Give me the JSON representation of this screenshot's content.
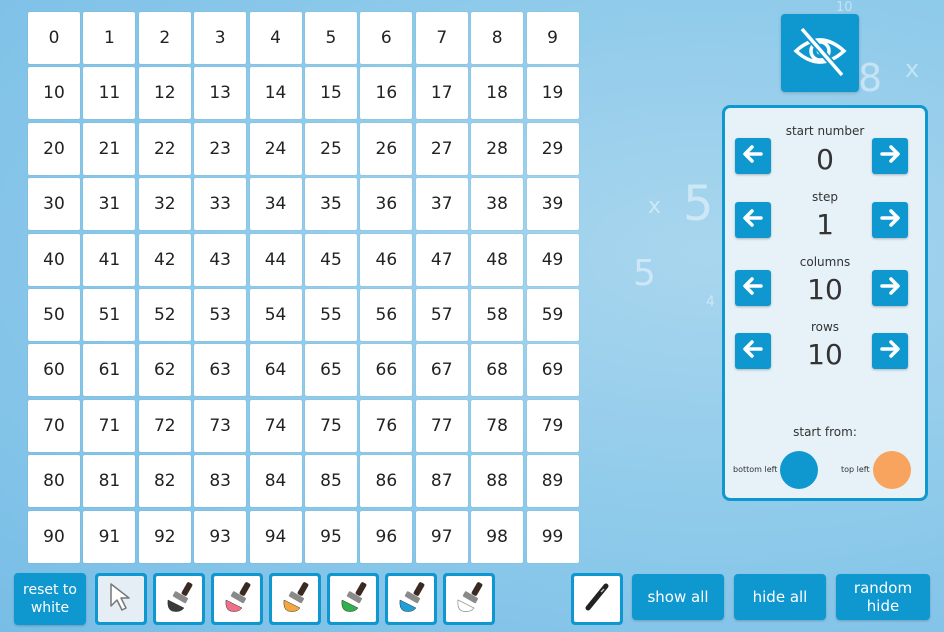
{
  "grid": {
    "rows": [
      [
        "0",
        "1",
        "2",
        "3",
        "4",
        "5",
        "6",
        "7",
        "8",
        "9"
      ],
      [
        "10",
        "11",
        "12",
        "13",
        "14",
        "15",
        "16",
        "17",
        "18",
        "19"
      ],
      [
        "20",
        "21",
        "22",
        "23",
        "24",
        "25",
        "26",
        "27",
        "28",
        "29"
      ],
      [
        "30",
        "31",
        "32",
        "33",
        "34",
        "35",
        "36",
        "37",
        "38",
        "39"
      ],
      [
        "40",
        "41",
        "42",
        "43",
        "44",
        "45",
        "46",
        "47",
        "48",
        "49"
      ],
      [
        "50",
        "51",
        "52",
        "53",
        "54",
        "55",
        "56",
        "57",
        "58",
        "59"
      ],
      [
        "60",
        "61",
        "62",
        "63",
        "64",
        "65",
        "66",
        "67",
        "68",
        "69"
      ],
      [
        "70",
        "71",
        "72",
        "73",
        "74",
        "75",
        "76",
        "77",
        "78",
        "79"
      ],
      [
        "80",
        "81",
        "82",
        "83",
        "84",
        "85",
        "86",
        "87",
        "88",
        "89"
      ],
      [
        "90",
        "91",
        "92",
        "93",
        "94",
        "95",
        "96",
        "97",
        "98",
        "99"
      ]
    ]
  },
  "background_numbers": [
    "10",
    "8",
    "x",
    "x",
    "5",
    "5",
    "4"
  ],
  "panel": {
    "start_number": {
      "label": "start number",
      "value": "0"
    },
    "step": {
      "label": "step",
      "value": "1"
    },
    "columns": {
      "label": "columns",
      "value": "10"
    },
    "rows": {
      "label": "rows",
      "value": "10"
    },
    "start_from_label": "start from:",
    "bottom_left_label": "bottom left",
    "top_left_label": "top left"
  },
  "buttons": {
    "reset_to_white": "reset to white",
    "show_all": "show all",
    "hide_all": "hide all",
    "random_hide": "random hide"
  },
  "icons": {
    "eye": "eye-slash-icon",
    "arrow_left": "arrow-left-icon",
    "arrow_right": "arrow-right-icon",
    "select": "cursor-icon",
    "brush": "paintbrush-icon",
    "pen": "pen-icon"
  },
  "colors": {
    "accent": "#0f97cf",
    "bottom_left_circle": "#0f97cf",
    "top_left_circle": "#f9a45e",
    "brushes": [
      "#3a3a3a",
      "#f0708a",
      "#f4a640",
      "#2fb14c",
      "#1e9fd8",
      "#ffffff"
    ]
  }
}
